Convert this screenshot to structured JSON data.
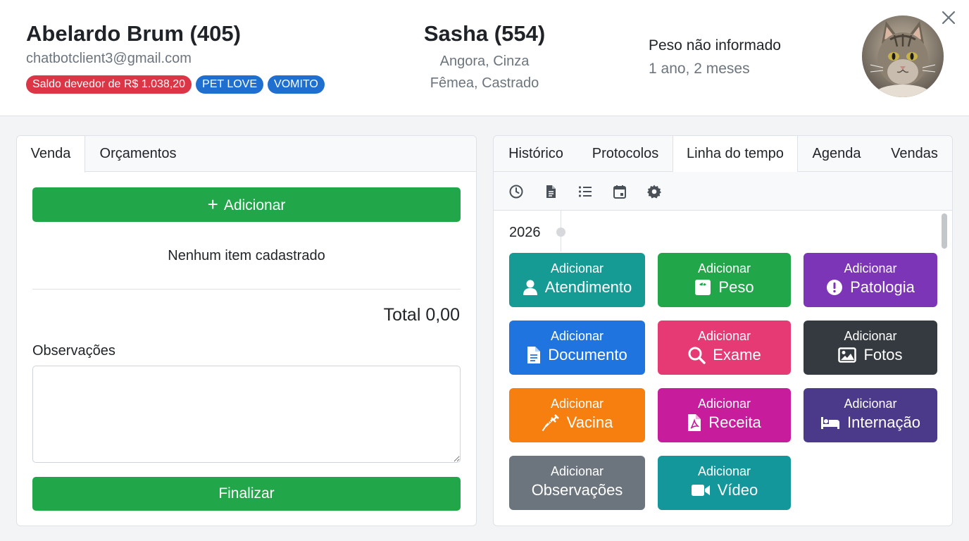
{
  "owner": {
    "name": "Abelardo Brum (405)",
    "email": "chatbotclient3@gmail.com",
    "badges": [
      {
        "text": "Saldo devedor de R$ 1.038,20",
        "color": "#dc3545"
      },
      {
        "text": "PET LOVE",
        "color": "#1f6fd0"
      },
      {
        "text": "VOMITO",
        "color": "#1f6fd0"
      }
    ]
  },
  "pet": {
    "name": "Sasha (554)",
    "breed_color": "Angora, Cinza",
    "sex_status": "Fêmea, Castrado",
    "weight": "Peso não informado",
    "age": "1 ano, 2 meses",
    "avatar_icon": "cat-photo"
  },
  "left": {
    "tabs": [
      "Venda",
      "Orçamentos"
    ],
    "active_tab": "Venda",
    "add_label": "Adicionar",
    "empty_message": "Nenhum item cadastrado",
    "total": "Total 0,00",
    "observations_label": "Observações",
    "observations_value": "",
    "finish_label": "Finalizar"
  },
  "right": {
    "tabs": [
      "Histórico",
      "Protocolos",
      "Linha do tempo",
      "Agenda",
      "Vendas"
    ],
    "active_tab": "Linha do tempo",
    "toolbar_icons": [
      "clock-icon",
      "document-icon",
      "list-icon",
      "calendar-icon",
      "gear-icon"
    ],
    "year": "2026",
    "tiles": [
      {
        "small": "Adicionar",
        "big": "Atendimento",
        "icon": "user-icon",
        "color": "#169a94"
      },
      {
        "small": "Adicionar",
        "big": "Peso",
        "icon": "scale-icon",
        "color": "#21a74a"
      },
      {
        "small": "Adicionar",
        "big": "Patologia",
        "icon": "alert-icon",
        "color": "#7b35b6"
      },
      {
        "small": "Adicionar",
        "big": "Documento",
        "icon": "file-icon",
        "color": "#1f74df"
      },
      {
        "small": "Adicionar",
        "big": "Exame",
        "icon": "magnifier-icon",
        "color": "#e63a75"
      },
      {
        "small": "Adicionar",
        "big": "Fotos",
        "icon": "image-icon",
        "color": "#343a40"
      },
      {
        "small": "Adicionar",
        "big": "Vacina",
        "icon": "syringe-icon",
        "color": "#f77f10"
      },
      {
        "small": "Adicionar",
        "big": "Receita",
        "icon": "pdf-icon",
        "color": "#c71d9c"
      },
      {
        "small": "Adicionar",
        "big": "Internação",
        "icon": "bed-icon",
        "color": "#4b3a8a"
      },
      {
        "small": "Adicionar",
        "big": "Observações",
        "icon": "",
        "color": "#6c757d"
      },
      {
        "small": "Adicionar",
        "big": "Vídeo",
        "icon": "video-icon",
        "color": "#14979a"
      }
    ]
  }
}
